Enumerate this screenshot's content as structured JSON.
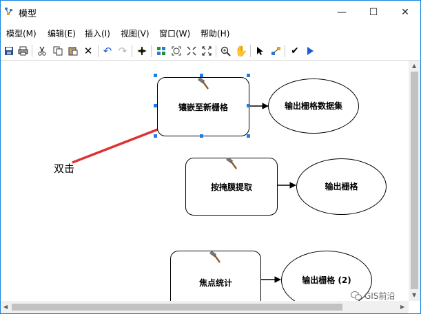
{
  "window": {
    "title": "模型",
    "controls": [
      "—",
      "☐",
      "✕"
    ]
  },
  "menubar": {
    "items": [
      {
        "label": "模型(M)"
      },
      {
        "label": "编辑(E)"
      },
      {
        "label": "插入(I)"
      },
      {
        "label": "视图(V)"
      },
      {
        "label": "窗口(W)"
      },
      {
        "label": "帮助(H)"
      }
    ]
  },
  "toolbar": {
    "icons": [
      "save-icon",
      "print-icon",
      "cut-icon",
      "copy-icon",
      "paste-icon",
      "delete-icon",
      "undo-icon",
      "redo-icon",
      "add-data-icon",
      "auto-layout-icon",
      "full-extent-icon",
      "zoom-in-fixed-icon",
      "zoom-out-fixed-icon",
      "zoom-in-icon",
      "pan-icon",
      "select-icon",
      "connect-icon",
      "validate-icon",
      "run-icon"
    ]
  },
  "model": {
    "processes": [
      {
        "label": "镶嵌至新栅格",
        "output": "输出栅格数据集",
        "selected": true
      },
      {
        "label": "按掩膜提取",
        "output": "输出栅格"
      },
      {
        "label": "焦点统计",
        "output": "输出栅格 (2)"
      }
    ],
    "annotation": "双击"
  },
  "watermark": "GIS前沿",
  "colors": {
    "selection": "#1e7fe0",
    "annotation_arrow": "#e03131",
    "run": "#1e5bd6"
  }
}
